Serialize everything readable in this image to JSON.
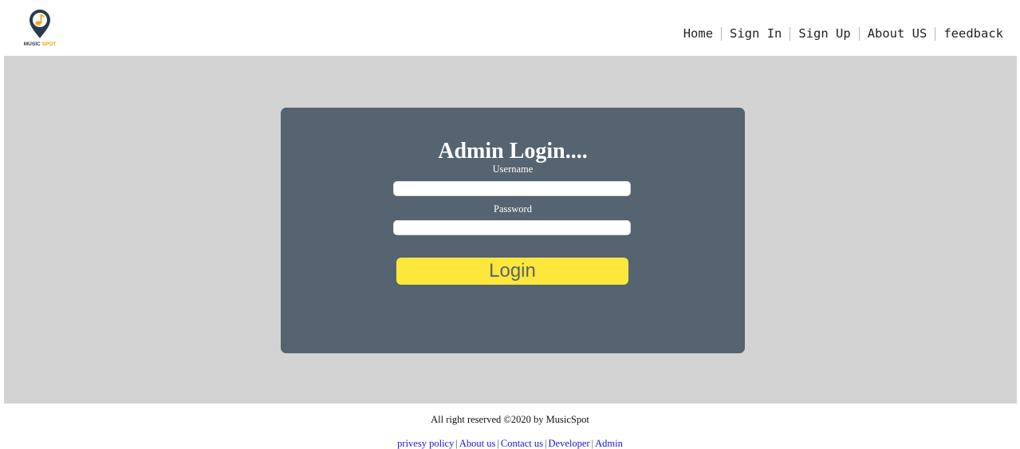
{
  "header": {
    "logo": {
      "icon": "map-pin-music-note-icon",
      "text_part1": "MUSIC",
      "text_part2": "SPOT",
      "brand_dark": "#2b3a4a",
      "brand_orange": "#f0a21b"
    },
    "nav": [
      {
        "label": "Home"
      },
      {
        "label": "Sign In"
      },
      {
        "label": "Sign Up"
      },
      {
        "label": "About US"
      },
      {
        "label": "feedback"
      }
    ]
  },
  "login_card": {
    "title": "Admin Login....",
    "username_label": "Username",
    "username_value": "",
    "password_label": "Password",
    "password_value": "",
    "login_button": "Login"
  },
  "footer": {
    "copyright": "All right reserved ©2020 by MusicSpot",
    "links": [
      {
        "label": "privesy policy"
      },
      {
        "label": "About us"
      },
      {
        "label": "Contact us"
      },
      {
        "label": "Developer"
      },
      {
        "label": "Admin"
      }
    ]
  },
  "colors": {
    "page_bg": "#ffffff",
    "main_bg": "#d3d3d3",
    "card_bg": "#566370",
    "button_bg": "#fde73a",
    "link_color": "#1a1ad8"
  }
}
